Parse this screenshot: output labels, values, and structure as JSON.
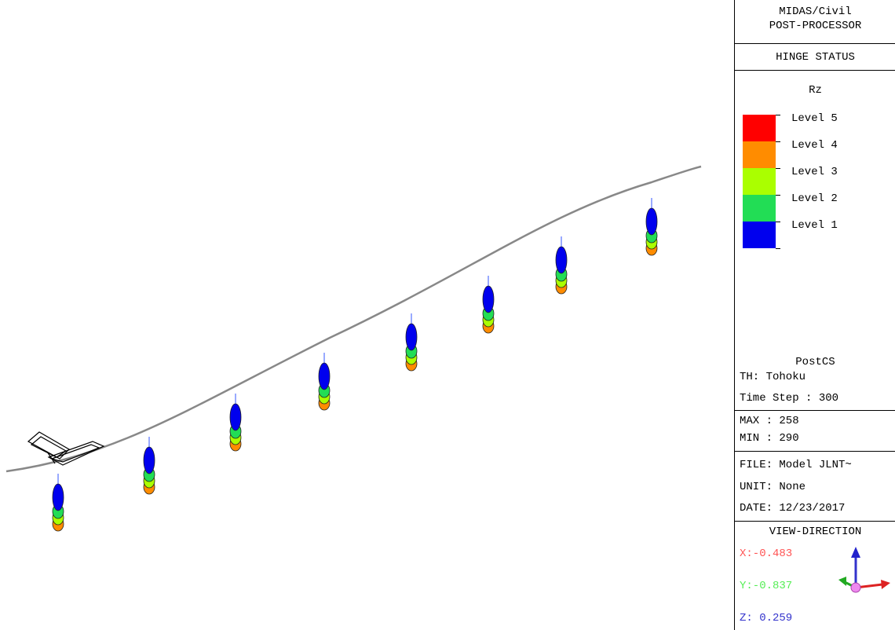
{
  "panel": {
    "app_line1": "MIDAS/Civil",
    "app_line2": "POST-PROCESSOR",
    "section_title": "HINGE STATUS",
    "component": "Rz",
    "legend": [
      {
        "label": "Level 5",
        "color": "#ff0000"
      },
      {
        "label": "Level 4",
        "color": "#ff8c00"
      },
      {
        "label": "Level 3",
        "color": "#aaff00"
      },
      {
        "label": "Level 2",
        "color": "#22dd55"
      },
      {
        "label": "Level 1",
        "color": "#0000ee"
      }
    ],
    "stage": "PostCS",
    "th": "TH: Tohoku",
    "time_step": "Time Step : 300",
    "max": "MAX : 258",
    "min": "MIN : 290",
    "file": "FILE: Model JLNT~",
    "unit": "UNIT: None",
    "date": "DATE: 12/23/2017",
    "view_title": "VIEW-DIRECTION",
    "view_x": "X:-0.483",
    "view_y": "Y:-0.837",
    "view_z": "Z: 0.259",
    "colors": {
      "x": "#ff5555",
      "y": "#55ee55",
      "z": "#3333cc"
    }
  },
  "model": {
    "hinge_colors": [
      "#0000ee",
      "#22dd55",
      "#aaff00",
      "#ff8c00"
    ],
    "deck_color": "#888888"
  }
}
